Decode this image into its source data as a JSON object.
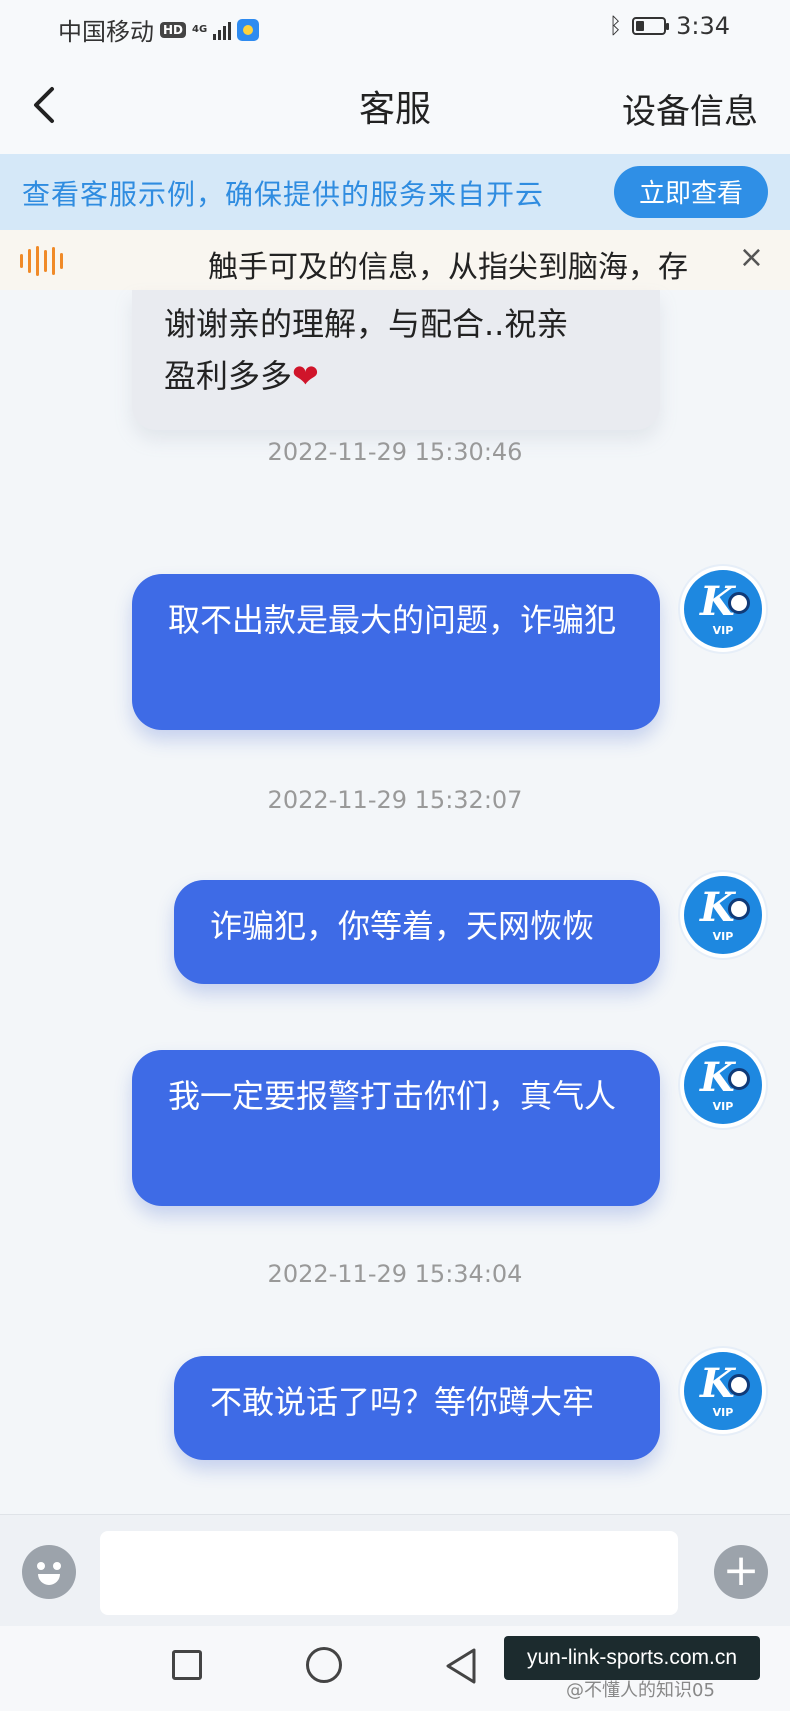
{
  "status_bar": {
    "carrier": "中国移动",
    "hd": "HD",
    "network": "4G",
    "time": "3:34",
    "bluetooth_icon": "bluetooth-icon",
    "battery_icon": "battery-icon",
    "battery_level": 0.3
  },
  "header": {
    "title": "客服",
    "right_action": "设备信息",
    "back_icon": "chevron-left-icon"
  },
  "banner": {
    "text": "查看客服示例，确保提供的服务来自开云",
    "button": "立即查看"
  },
  "notice": {
    "text": "触手可及的信息，从指尖到脑海，存",
    "close": "×",
    "icon": "sound-wave-icon"
  },
  "messages": {
    "partial_line1": "谢谢亲的理解，与配合..祝亲",
    "partial_line2": "盈利多多",
    "heart": "❤",
    "ts1": "2022-11-29 15:30:46",
    "m1": "取不出款是最大的问题，诈骗犯",
    "ts2": "2022-11-29 15:32:07",
    "m2": "诈骗犯，你等着，天网恢恢",
    "m3": "我一定要报警打击你们，真气人",
    "ts3": "2022-11-29 15:34:04",
    "m4": "不敢说话了吗？等你蹲大牢"
  },
  "avatar": {
    "letter": "K",
    "badge": "VIP"
  },
  "input_bar": {
    "placeholder": "",
    "emoji_icon": "emoji-icon",
    "plus_icon": "plus-icon"
  },
  "watermark": {
    "text": "yun-link-sports.com.cn",
    "credit": "@不懂人的知识05"
  },
  "colors": {
    "bubble": "#3e6be6",
    "banner_text": "#2f8ce0",
    "banner_button": "#2f8fe6",
    "avatar": "#1e88e0"
  }
}
